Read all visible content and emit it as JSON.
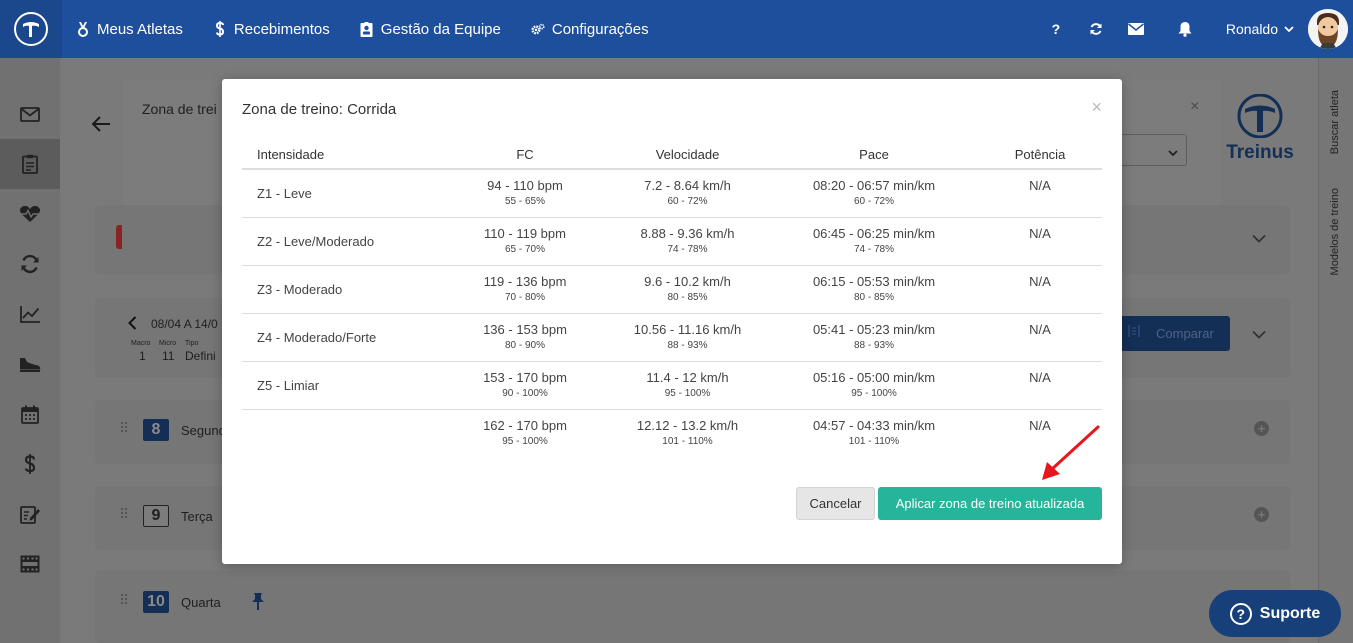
{
  "topbar": {
    "nav": [
      {
        "label": "Meus Atletas",
        "icon": "medal-icon"
      },
      {
        "label": "Recebimentos",
        "icon": "dollar-icon"
      },
      {
        "label": "Gestão da Equipe",
        "icon": "badge-icon"
      },
      {
        "label": "Configurações",
        "icon": "gears-icon"
      }
    ],
    "help_glyph": "?",
    "user_name": "Ronaldo"
  },
  "right_tabs": [
    "Buscar atleta",
    "Modelos de treino"
  ],
  "background": {
    "panel_title": "Zona de trei",
    "brand": "Treinus",
    "week_range": "08/04 A 14/0",
    "macro_label": "Macro",
    "micro_label": "Micro",
    "tipo_label": "Tipo",
    "macro_value": "1",
    "micro_value": "11",
    "tipo_value": "Defini",
    "compare_label": "Comparar",
    "days": [
      {
        "num": "8",
        "name": "Segund"
      },
      {
        "num": "9",
        "name": "Terça"
      },
      {
        "num": "10",
        "name": "Quarta"
      }
    ]
  },
  "modal": {
    "title": "Zona de treino: Corrida",
    "close_glyph": "×",
    "headers": [
      "Intensidade",
      "FC",
      "Velocidade",
      "Pace",
      "Potência"
    ],
    "rows": [
      {
        "name": "Z1 - Leve",
        "fc": "94 - 110 bpm",
        "fc_pct": "55 - 65%",
        "vel": "7.2 - 8.64 km/h",
        "vel_pct": "60 - 72%",
        "pace": "08:20 - 06:57 min/km",
        "pace_pct": "60 - 72%",
        "pot": "N/A"
      },
      {
        "name": "Z2 - Leve/Moderado",
        "fc": "110 - 119 bpm",
        "fc_pct": "65 - 70%",
        "vel": "8.88 - 9.36 km/h",
        "vel_pct": "74 - 78%",
        "pace": "06:45 - 06:25 min/km",
        "pace_pct": "74 - 78%",
        "pot": "N/A"
      },
      {
        "name": "Z3 - Moderado",
        "fc": "119 - 136 bpm",
        "fc_pct": "70 - 80%",
        "vel": "9.6 - 10.2 km/h",
        "vel_pct": "80 - 85%",
        "pace": "06:15 - 05:53 min/km",
        "pace_pct": "80 - 85%",
        "pot": "N/A"
      },
      {
        "name": "Z4 - Moderado/Forte",
        "fc": "136 - 153 bpm",
        "fc_pct": "80 - 90%",
        "vel": "10.56 - 11.16 km/h",
        "vel_pct": "88 - 93%",
        "pace": "05:41 - 05:23 min/km",
        "pace_pct": "88 - 93%",
        "pot": "N/A"
      },
      {
        "name": "Z5 - Limiar",
        "fc": "153 - 170 bpm",
        "fc_pct": "90 - 100%",
        "vel": "11.4 - 12 km/h",
        "vel_pct": "95 - 100%",
        "pace": "05:16 - 05:00 min/km",
        "pace_pct": "95 - 100%",
        "pot": "N/A"
      },
      {
        "name": "",
        "fc": "162 - 170 bpm",
        "fc_pct": "95 - 100%",
        "vel": "12.12 - 13.2 km/h",
        "vel_pct": "101 - 110%",
        "pace": "04:57 - 04:33 min/km",
        "pace_pct": "101 - 110%",
        "pot": "N/A"
      }
    ],
    "cancel_label": "Cancelar",
    "apply_label": "Aplicar zona de treino atualizada"
  },
  "support": {
    "glyph": "?",
    "label": "Suporte"
  },
  "colors": {
    "topbar": "#1e4f9c",
    "apply_button": "#26b59a",
    "support_button": "#173f7a",
    "annotation_arrow": "#e8161b"
  }
}
